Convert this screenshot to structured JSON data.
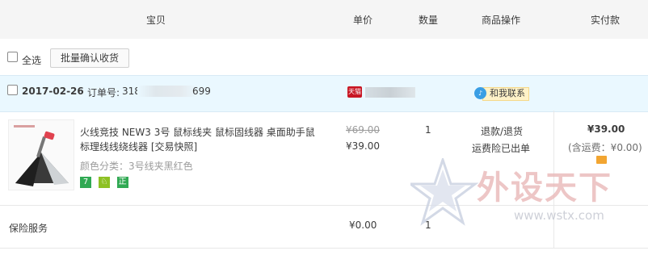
{
  "header": {
    "item": "宝贝",
    "unit_price": "单价",
    "quantity": "数量",
    "actions": "商品操作",
    "paid": "实付款"
  },
  "toolbar": {
    "select_all": "全选",
    "batch_confirm": "批量确认收货"
  },
  "order": {
    "date": "2017-02-26",
    "number_label": "订单号:",
    "number_visible": "318",
    "number_tail": "699",
    "contact_label": "和我联系",
    "store_badge": "天猫"
  },
  "product": {
    "title": "火线竞技 NEW3 3号 鼠标线夹 鼠标固线器 桌面助手鼠标理线线绕线器 [交易快照]",
    "color": "颜色分类：3号线夹黑红色",
    "badges": [
      {
        "label": "7",
        "color": "#30a953"
      },
      {
        "label": "♘",
        "color": "#8ec124"
      },
      {
        "label": "正",
        "color": "#30a953"
      }
    ],
    "original_price": "¥69.00",
    "price": "¥39.00",
    "quantity": "1",
    "action_refund": "退款/退货",
    "action_shipping": "运费险已出单",
    "total": "¥39.00",
    "shipping_note": "(含运费：¥0.00)"
  },
  "insurance": {
    "label": "保险服务",
    "price": "¥0.00",
    "quantity": "1"
  },
  "watermark": {
    "text": "外设天下",
    "url": "www.wstx.com"
  }
}
